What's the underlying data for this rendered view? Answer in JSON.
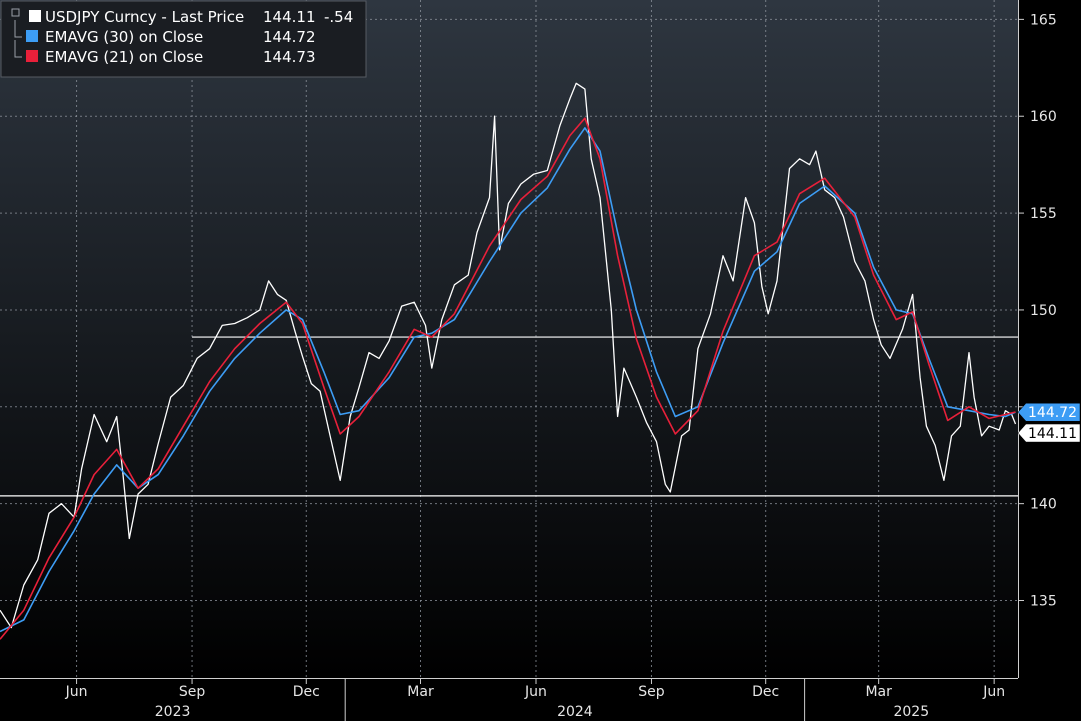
{
  "chart_data": {
    "type": "line",
    "grid": true,
    "ylim": [
      131,
      166
    ],
    "xlim": [
      "2023-04-01",
      "2025-06-20"
    ],
    "y_ticks": [
      135,
      140,
      145,
      150,
      155,
      160,
      165
    ],
    "y_tick_labels": [
      "135",
      "140",
      "",
      "150",
      "155",
      "160",
      "165"
    ],
    "x_month_ticks": [
      {
        "date": "2023-06-01",
        "label": "Jun"
      },
      {
        "date": "2023-09-01",
        "label": "Sep"
      },
      {
        "date": "2023-12-01",
        "label": "Dec"
      },
      {
        "date": "2024-03-01",
        "label": "Mar"
      },
      {
        "date": "2024-06-01",
        "label": "Jun"
      },
      {
        "date": "2024-09-01",
        "label": "Sep"
      },
      {
        "date": "2024-12-01",
        "label": "Dec"
      },
      {
        "date": "2025-03-01",
        "label": "Mar"
      },
      {
        "date": "2025-06-01",
        "label": "Jun"
      }
    ],
    "x_year_labels": [
      {
        "label": "2023",
        "start": "2023-04-01",
        "end": "2024-01-01"
      },
      {
        "label": "2024",
        "start": "2024-01-01",
        "end": "2025-01-01"
      },
      {
        "label": "2025",
        "start": "2025-01-01",
        "end": "2025-06-20"
      }
    ],
    "legend": {
      "placement": "top-left",
      "items": [
        {
          "label": "USDJPY Curncy - Last Price",
          "value": "144.11",
          "change": "-.54",
          "color": "#ffffff"
        },
        {
          "label": "EMAVG (30)  on Close",
          "value": "144.72",
          "color": "#3d9df5"
        },
        {
          "label": "EMAVG (21)  on Close",
          "value": "144.73",
          "color": "#e8203a"
        }
      ]
    },
    "reference_lines": [
      {
        "y": 148.6,
        "start": "2023-09-01",
        "color": "#ffffff"
      },
      {
        "y": 140.4,
        "start": "2023-04-01",
        "color": "#ffffff"
      }
    ],
    "last_value_tags": [
      {
        "value": "144.72",
        "y": 144.72,
        "color": "#3d9df5"
      },
      {
        "value": "144.11",
        "y": 144.11,
        "color": "#ffffff"
      }
    ],
    "series": [
      {
        "name": "USDJPY Curncy - Last Price",
        "color": "#ffffff",
        "points": [
          [
            "2023-04-01",
            134.5
          ],
          [
            "2023-04-10",
            133.6
          ],
          [
            "2023-04-20",
            135.8
          ],
          [
            "2023-05-01",
            137.1
          ],
          [
            "2023-05-10",
            139.5
          ],
          [
            "2023-05-20",
            140.0
          ],
          [
            "2023-05-30",
            139.3
          ],
          [
            "2023-06-05",
            141.8
          ],
          [
            "2023-06-15",
            144.6
          ],
          [
            "2023-06-25",
            143.2
          ],
          [
            "2023-07-03",
            144.5
          ],
          [
            "2023-07-08",
            141.5
          ],
          [
            "2023-07-13",
            138.2
          ],
          [
            "2023-07-20",
            140.5
          ],
          [
            "2023-07-28",
            141.0
          ],
          [
            "2023-08-05",
            143.1
          ],
          [
            "2023-08-15",
            145.5
          ],
          [
            "2023-08-25",
            146.1
          ],
          [
            "2023-09-05",
            147.5
          ],
          [
            "2023-09-15",
            148.0
          ],
          [
            "2023-09-25",
            149.2
          ],
          [
            "2023-10-05",
            149.3
          ],
          [
            "2023-10-15",
            149.6
          ],
          [
            "2023-10-25",
            150.0
          ],
          [
            "2023-11-01",
            151.5
          ],
          [
            "2023-11-08",
            150.8
          ],
          [
            "2023-11-15",
            150.5
          ],
          [
            "2023-11-22",
            148.9
          ],
          [
            "2023-11-28",
            147.6
          ],
          [
            "2023-12-05",
            146.2
          ],
          [
            "2023-12-12",
            145.8
          ],
          [
            "2023-12-20",
            143.5
          ],
          [
            "2023-12-28",
            141.2
          ],
          [
            "2024-01-05",
            144.5
          ],
          [
            "2024-01-12",
            146.0
          ],
          [
            "2024-01-20",
            147.8
          ],
          [
            "2024-01-28",
            147.5
          ],
          [
            "2024-02-05",
            148.4
          ],
          [
            "2024-02-15",
            150.2
          ],
          [
            "2024-02-25",
            150.4
          ],
          [
            "2024-03-05",
            149.2
          ],
          [
            "2024-03-10",
            147.0
          ],
          [
            "2024-03-18",
            149.5
          ],
          [
            "2024-03-28",
            151.3
          ],
          [
            "2024-04-08",
            151.8
          ],
          [
            "2024-04-15",
            154.0
          ],
          [
            "2024-04-25",
            155.8
          ],
          [
            "2024-04-29",
            160.0
          ],
          [
            "2024-05-03",
            153.1
          ],
          [
            "2024-05-10",
            155.5
          ],
          [
            "2024-05-20",
            156.5
          ],
          [
            "2024-05-30",
            157.0
          ],
          [
            "2024-06-10",
            157.2
          ],
          [
            "2024-06-20",
            159.5
          ],
          [
            "2024-06-28",
            160.9
          ],
          [
            "2024-07-03",
            161.7
          ],
          [
            "2024-07-10",
            161.4
          ],
          [
            "2024-07-15",
            157.8
          ],
          [
            "2024-07-22",
            155.8
          ],
          [
            "2024-07-31",
            150.0
          ],
          [
            "2024-08-05",
            144.5
          ],
          [
            "2024-08-10",
            147.0
          ],
          [
            "2024-08-20",
            145.5
          ],
          [
            "2024-08-28",
            144.2
          ],
          [
            "2024-09-05",
            143.2
          ],
          [
            "2024-09-12",
            141.0
          ],
          [
            "2024-09-16",
            140.6
          ],
          [
            "2024-09-25",
            143.5
          ],
          [
            "2024-10-01",
            143.8
          ],
          [
            "2024-10-08",
            148.0
          ],
          [
            "2024-10-18",
            149.8
          ],
          [
            "2024-10-28",
            152.8
          ],
          [
            "2024-11-05",
            151.5
          ],
          [
            "2024-11-15",
            155.8
          ],
          [
            "2024-11-22",
            154.5
          ],
          [
            "2024-11-28",
            151.2
          ],
          [
            "2024-12-03",
            149.8
          ],
          [
            "2024-12-10",
            151.5
          ],
          [
            "2024-12-20",
            157.3
          ],
          [
            "2024-12-28",
            157.8
          ],
          [
            "2025-01-05",
            157.5
          ],
          [
            "2025-01-10",
            158.2
          ],
          [
            "2025-01-17",
            156.2
          ],
          [
            "2025-01-25",
            155.8
          ],
          [
            "2025-02-01",
            154.8
          ],
          [
            "2025-02-10",
            152.5
          ],
          [
            "2025-02-18",
            151.5
          ],
          [
            "2025-02-25",
            149.5
          ],
          [
            "2025-03-03",
            148.2
          ],
          [
            "2025-03-10",
            147.5
          ],
          [
            "2025-03-20",
            149.0
          ],
          [
            "2025-03-28",
            150.8
          ],
          [
            "2025-04-03",
            146.5
          ],
          [
            "2025-04-08",
            144.0
          ],
          [
            "2025-04-15",
            143.0
          ],
          [
            "2025-04-22",
            141.2
          ],
          [
            "2025-04-28",
            143.5
          ],
          [
            "2025-05-05",
            144.0
          ],
          [
            "2025-05-12",
            147.8
          ],
          [
            "2025-05-16",
            145.5
          ],
          [
            "2025-05-22",
            143.5
          ],
          [
            "2025-05-28",
            144.0
          ],
          [
            "2025-06-05",
            143.8
          ],
          [
            "2025-06-10",
            144.8
          ],
          [
            "2025-06-15",
            144.6
          ],
          [
            "2025-06-18",
            144.11
          ]
        ]
      },
      {
        "name": "EMAVG (30)  on Close",
        "color": "#3d9df5",
        "points": [
          [
            "2023-04-01",
            133.4
          ],
          [
            "2023-04-20",
            134.0
          ],
          [
            "2023-05-10",
            136.5
          ],
          [
            "2023-05-30",
            138.6
          ],
          [
            "2023-06-15",
            140.5
          ],
          [
            "2023-07-03",
            142.0
          ],
          [
            "2023-07-20",
            140.8
          ],
          [
            "2023-08-05",
            141.5
          ],
          [
            "2023-08-25",
            143.5
          ],
          [
            "2023-09-15",
            145.8
          ],
          [
            "2023-10-05",
            147.5
          ],
          [
            "2023-10-25",
            148.8
          ],
          [
            "2023-11-15",
            150.0
          ],
          [
            "2023-11-28",
            149.5
          ],
          [
            "2023-12-15",
            146.8
          ],
          [
            "2023-12-28",
            144.6
          ],
          [
            "2024-01-12",
            144.8
          ],
          [
            "2024-02-05",
            146.5
          ],
          [
            "2024-02-25",
            148.6
          ],
          [
            "2024-03-10",
            148.8
          ],
          [
            "2024-03-28",
            149.5
          ],
          [
            "2024-04-25",
            152.5
          ],
          [
            "2024-05-20",
            155.0
          ],
          [
            "2024-06-10",
            156.3
          ],
          [
            "2024-06-28",
            158.3
          ],
          [
            "2024-07-10",
            159.4
          ],
          [
            "2024-07-22",
            158.2
          ],
          [
            "2024-08-05",
            154.0
          ],
          [
            "2024-08-20",
            150.0
          ],
          [
            "2024-09-05",
            146.8
          ],
          [
            "2024-09-20",
            144.5
          ],
          [
            "2024-10-08",
            145.0
          ],
          [
            "2024-10-28",
            148.3
          ],
          [
            "2024-11-22",
            152.0
          ],
          [
            "2024-12-10",
            153.0
          ],
          [
            "2024-12-28",
            155.5
          ],
          [
            "2025-01-17",
            156.4
          ],
          [
            "2025-02-10",
            155.0
          ],
          [
            "2025-02-25",
            152.2
          ],
          [
            "2025-03-15",
            150.0
          ],
          [
            "2025-03-28",
            149.8
          ],
          [
            "2025-04-10",
            147.5
          ],
          [
            "2025-04-25",
            145.0
          ],
          [
            "2025-05-12",
            144.8
          ],
          [
            "2025-05-28",
            144.6
          ],
          [
            "2025-06-10",
            144.5
          ],
          [
            "2025-06-18",
            144.72
          ]
        ]
      },
      {
        "name": "EMAVG (21)  on Close",
        "color": "#e8203a",
        "points": [
          [
            "2023-04-01",
            133.0
          ],
          [
            "2023-04-20",
            134.5
          ],
          [
            "2023-05-10",
            137.2
          ],
          [
            "2023-05-30",
            139.3
          ],
          [
            "2023-06-15",
            141.5
          ],
          [
            "2023-07-03",
            142.8
          ],
          [
            "2023-07-20",
            140.8
          ],
          [
            "2023-08-05",
            141.8
          ],
          [
            "2023-08-25",
            144.0
          ],
          [
            "2023-09-15",
            146.3
          ],
          [
            "2023-10-05",
            148.0
          ],
          [
            "2023-10-25",
            149.3
          ],
          [
            "2023-11-15",
            150.4
          ],
          [
            "2023-11-28",
            149.3
          ],
          [
            "2023-12-15",
            146.0
          ],
          [
            "2023-12-28",
            143.6
          ],
          [
            "2024-01-12",
            144.5
          ],
          [
            "2024-02-05",
            146.8
          ],
          [
            "2024-02-25",
            149.0
          ],
          [
            "2024-03-10",
            148.6
          ],
          [
            "2024-03-28",
            149.8
          ],
          [
            "2024-04-25",
            153.3
          ],
          [
            "2024-05-20",
            155.7
          ],
          [
            "2024-06-10",
            156.9
          ],
          [
            "2024-06-28",
            159.0
          ],
          [
            "2024-07-10",
            159.9
          ],
          [
            "2024-07-22",
            157.8
          ],
          [
            "2024-08-05",
            152.8
          ],
          [
            "2024-08-20",
            148.5
          ],
          [
            "2024-09-05",
            145.5
          ],
          [
            "2024-09-20",
            143.6
          ],
          [
            "2024-10-08",
            144.8
          ],
          [
            "2024-10-28",
            148.9
          ],
          [
            "2024-11-22",
            152.8
          ],
          [
            "2024-12-10",
            153.5
          ],
          [
            "2024-12-28",
            156.0
          ],
          [
            "2025-01-17",
            156.8
          ],
          [
            "2025-02-10",
            154.8
          ],
          [
            "2025-02-25",
            151.8
          ],
          [
            "2025-03-15",
            149.5
          ],
          [
            "2025-03-28",
            149.9
          ],
          [
            "2025-04-10",
            147.2
          ],
          [
            "2025-04-25",
            144.3
          ],
          [
            "2025-05-12",
            145.0
          ],
          [
            "2025-05-28",
            144.4
          ],
          [
            "2025-06-10",
            144.6
          ],
          [
            "2025-06-18",
            144.73
          ]
        ]
      }
    ]
  }
}
